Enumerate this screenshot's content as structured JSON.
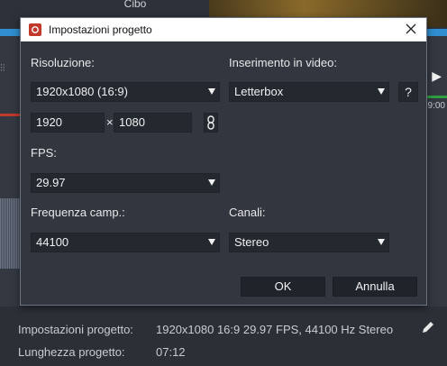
{
  "background": {
    "category_label": "Cibo",
    "timeline_time": "9:00"
  },
  "dialog": {
    "title": "Impostazioni progetto",
    "resolution": {
      "label": "Risoluzione:",
      "selected": "1920x1080 (16:9)",
      "width": "1920",
      "height": "1080",
      "times_symbol": "×"
    },
    "fit": {
      "label": "Inserimento in video:",
      "selected": "Letterbox",
      "help": "?"
    },
    "fps": {
      "label": "FPS:",
      "selected": "29.97"
    },
    "sample_rate": {
      "label": "Frequenza camp.:",
      "selected": "44100"
    },
    "channels": {
      "label": "Canali:",
      "selected": "Stereo"
    },
    "ok_label": "OK",
    "cancel_label": "Annulla"
  },
  "status": {
    "settings_label": "Impostazioni progetto:",
    "settings_value": "1920x1080 16:9 29.97 FPS, 44100 Hz Stereo",
    "length_label": "Lunghezza progetto:",
    "length_value": "07:12"
  },
  "colors": {
    "accent_blue": "#2f8fd0",
    "dialog_bg": "#31363f",
    "field_bg": "#24282f",
    "app_icon": "#c0392b"
  }
}
